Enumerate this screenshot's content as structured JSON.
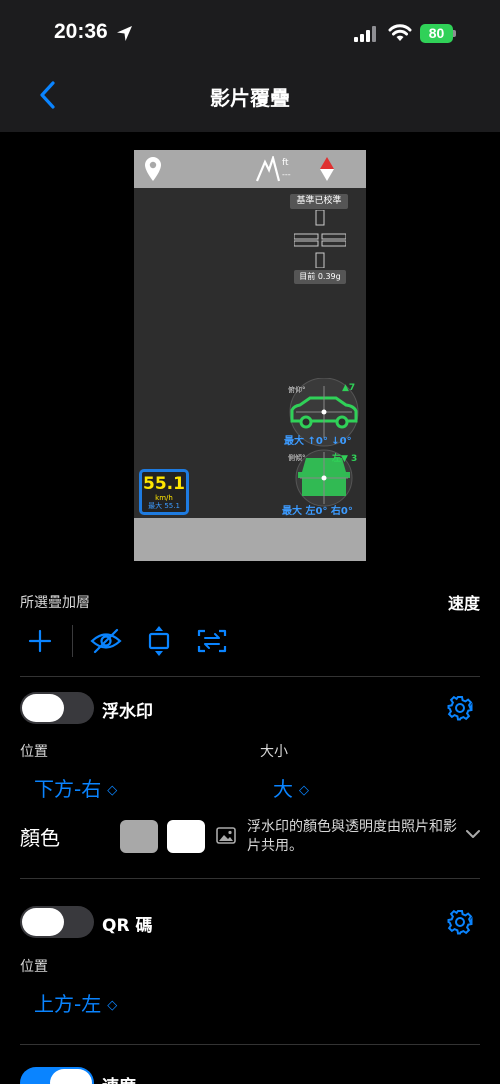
{
  "status": {
    "time": "20:36",
    "battery": "80"
  },
  "nav": {
    "title": "影片覆疊"
  },
  "preview": {
    "altitude_unit": "ft",
    "altitude_value": "---",
    "calibration": "基準已校準",
    "gforce": "目前 0.39g",
    "speed": {
      "value": "55.1",
      "unit": "km/h",
      "max": "最大 55.1"
    },
    "pitch": {
      "label": "俯仰°",
      "value": "▲7",
      "footer": "最大 ↑0° ↓0°"
    },
    "roll": {
      "label": "側傾°",
      "value": "左▼ 3",
      "footer": "最大 左0° 右0°"
    }
  },
  "selected_layer_label": "所選疊加層",
  "selected_layer_value": "速度",
  "watermark": {
    "title": "浮水印",
    "enabled": false,
    "position_label": "位置",
    "position_value": "下方-右",
    "size_label": "大小",
    "size_value": "大",
    "color_label": "顏色",
    "color_note": "浮水印的顏色與透明度由照片和影片共用。",
    "swatch_colors": [
      "#a8a8a8",
      "#ffffff"
    ]
  },
  "qr": {
    "title": "QR 碼",
    "enabled": false,
    "position_label": "位置",
    "position_value": "上方-左"
  },
  "speed_layer": {
    "title": "速度",
    "enabled": true
  },
  "colors": {
    "accent": "#0a84ff",
    "gauge_green": "#30d158",
    "speed_yellow": "#ffe600"
  }
}
